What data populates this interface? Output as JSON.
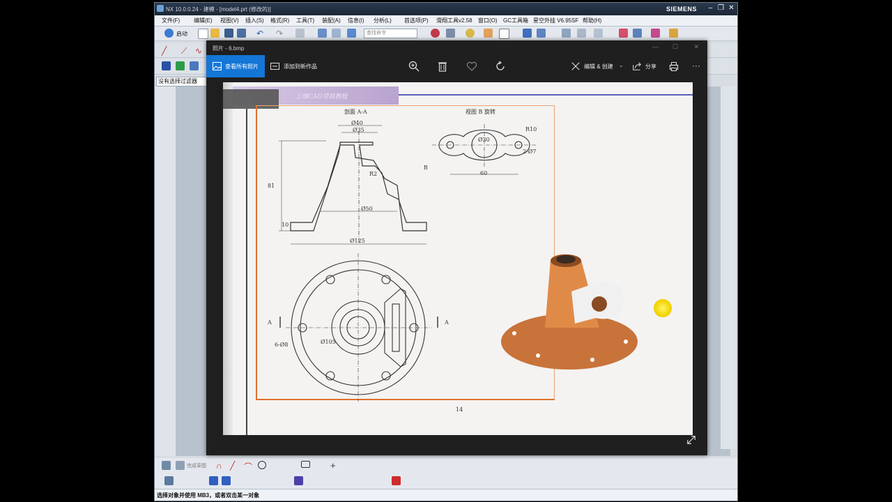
{
  "nx": {
    "title": "NX 10.0.0.24 - 建模 - [model4.prt (修改的)]",
    "brand": "SIEMENS",
    "menu": [
      "文件(F)",
      "编辑(E)",
      "视图(V)",
      "插入(S)",
      "格式(R)",
      "工具(T)",
      "装配(A)",
      "信息(I)",
      "分析(L)",
      "首选项(P)",
      "滑翔工具v2.58",
      "窗口(O)",
      "GC工具箱",
      "星空外挂 V6.95SF",
      "帮助(H)"
    ],
    "start_label": "启动",
    "command_search_placeholder": "查找命令",
    "selection_filter": "没有选择过滤器",
    "sketch_label": "完成草图",
    "status_text": "选择对象并使用 MB3，或者双击某一对象"
  },
  "viewer": {
    "title": "照片 - 6.bmp",
    "see_all_label": "查看所有照片",
    "add_to_creation_label": "添加到新作品",
    "edit_create_label": "编辑 & 创建",
    "share_label": "分享",
    "image": {
      "book_header": "三维CAD项目教程",
      "section_aa": "剖面 A-A",
      "view_b": "视图 B 旋转",
      "page_number": "14",
      "dims": {
        "phi40": "Ø40",
        "phi35": "Ø35",
        "phi50": "Ø50",
        "phi125": "Ø125",
        "phi105": "Ø105",
        "phi30": "Ø30",
        "h81": "81",
        "h10": "10",
        "r2": "R2",
        "w60": "60",
        "holes": "6-Ø8",
        "r10": "R10",
        "phi8": "2-Ø7",
        "b_mark": "B",
        "a_left": "A",
        "a_right": "A"
      }
    }
  }
}
